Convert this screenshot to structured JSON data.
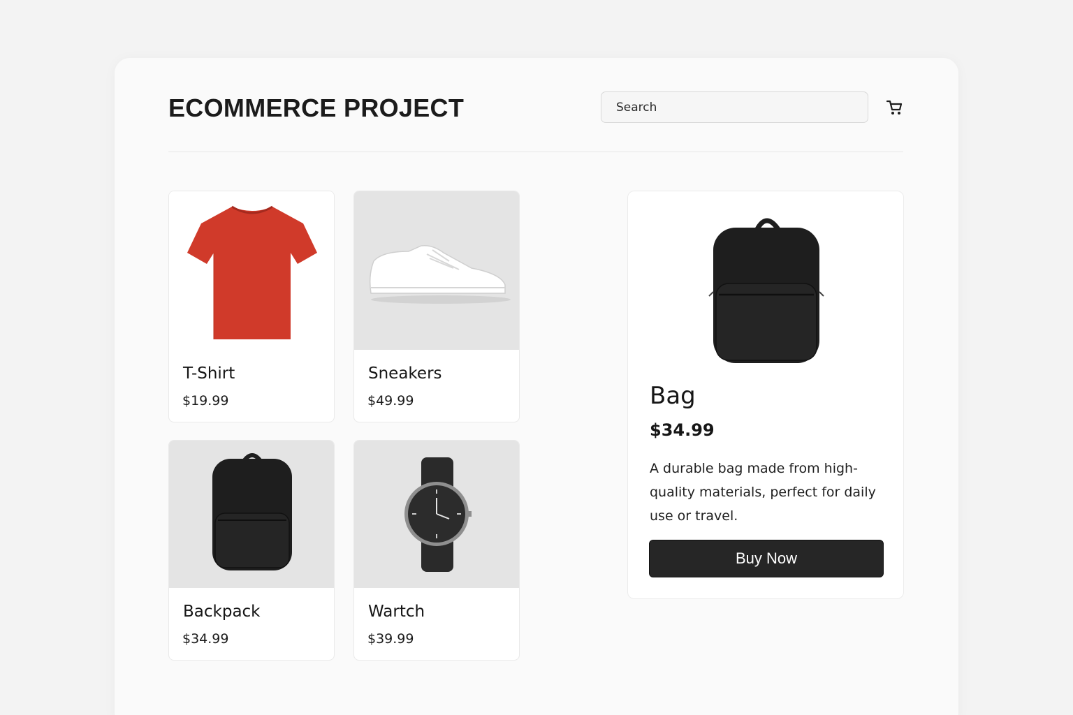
{
  "header": {
    "brand": "ECOMMERCE PROJECT",
    "search_placeholder": "Search",
    "cart_icon": "shopping-cart-icon"
  },
  "products": [
    {
      "name": "T-Shirt",
      "price": "$19.99",
      "image": "red-tshirt",
      "color": "#d03a2a"
    },
    {
      "name": "Sneakers",
      "price": "$49.99",
      "image": "white-sneaker",
      "color": "#ffffff"
    },
    {
      "name": "Backpack",
      "price": "$34.99",
      "image": "black-backpack",
      "color": "#1e1e1e"
    },
    {
      "name": "Wartch",
      "price": "$39.99",
      "image": "black-watch",
      "color": "#2a2a2a"
    }
  ],
  "detail": {
    "title": "Bag",
    "price": "$34.99",
    "description": "A durable bag made from high-quality materials, perfect for daily use or travel.",
    "button_label": "Buy Now",
    "image": "black-backpack"
  },
  "colors": {
    "background": "#f3f3f3",
    "panel": "#fafafa",
    "button": "#262626",
    "accent_red": "#d03a2a"
  }
}
